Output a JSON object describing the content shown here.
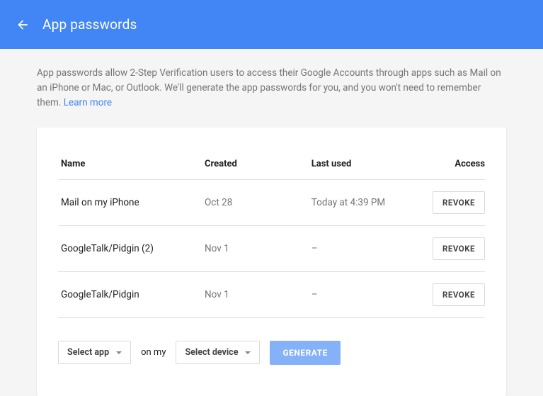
{
  "header": {
    "title": "App passwords"
  },
  "description": {
    "text": "App passwords allow 2-Step Verification users to access their Google Accounts through apps such as Mail on an iPhone or Mac, or Outlook. We'll generate the app passwords for you, and you won't need to remember them. ",
    "learn_more": "Learn more"
  },
  "table": {
    "headers": {
      "name": "Name",
      "created": "Created",
      "last_used": "Last used",
      "access": "Access"
    },
    "rows": [
      {
        "name": "Mail on my iPhone",
        "created": "Oct 28",
        "last_used": "Today at 4:39 PM"
      },
      {
        "name": "GoogleTalk/Pidgin (2)",
        "created": "Nov 1",
        "last_used": "–"
      },
      {
        "name": "GoogleTalk/Pidgin",
        "created": "Nov 1",
        "last_used": "–"
      }
    ],
    "revoke_label": "REVOKE"
  },
  "actions": {
    "select_app": "Select app",
    "on_my": "on my",
    "select_device": "Select device",
    "generate": "GENERATE"
  }
}
